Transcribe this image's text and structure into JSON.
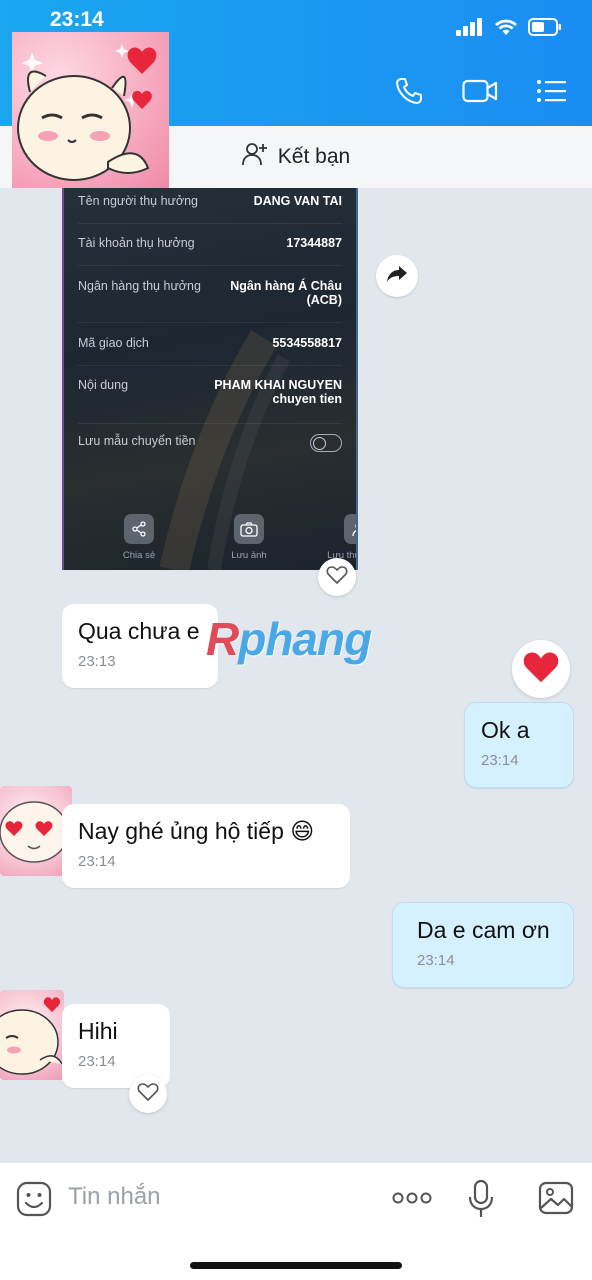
{
  "status": {
    "time": "23:14"
  },
  "header": {
    "add_friend_label": "Kết bạn"
  },
  "receipt": {
    "rows": [
      {
        "label": "Tên người thụ hưởng",
        "value": "DANG VAN TAI"
      },
      {
        "label": "Tài khoản thụ hưởng",
        "value": "17344887"
      },
      {
        "label": "Ngân hàng thụ hưởng",
        "value": "Ngân hàng Á Châu (ACB)"
      },
      {
        "label": "Mã giao dịch",
        "value": "5534558817"
      },
      {
        "label": "Nội dung",
        "value": "PHAM KHAI NGUYEN chuyen tien"
      },
      {
        "label": "Lưu mẫu chuyển tiền",
        "value": ""
      }
    ],
    "actions": [
      {
        "label": "Chia sẻ",
        "icon": "share-icon"
      },
      {
        "label": "Lưu ảnh",
        "icon": "camera-icon"
      },
      {
        "label": "Lưu thụ hưởng",
        "icon": "user-icon"
      }
    ]
  },
  "watermark": {
    "text_r": "R",
    "text_rest": "phang"
  },
  "messages": [
    {
      "text": "Qua chưa e",
      "time": "23:13",
      "direction": "in"
    },
    {
      "text": "Ok a",
      "time": "23:14",
      "direction": "out"
    },
    {
      "text": "Nay ghé ủng hộ tiếp 😄",
      "time": "23:14",
      "direction": "in"
    },
    {
      "text": "Da e cam ơn",
      "time": "23:14",
      "direction": "out"
    },
    {
      "text": "Hihi",
      "time": "23:14",
      "direction": "in"
    }
  ],
  "composer": {
    "placeholder": "Tin nhắn"
  },
  "colors": {
    "header_start": "#1aa7ef",
    "header_end": "#1a8df3",
    "out_bubble": "#d5f1ff",
    "in_bubble": "#ffffff",
    "chat_bg": "#e2e7ee",
    "heart": "#e8263b"
  }
}
